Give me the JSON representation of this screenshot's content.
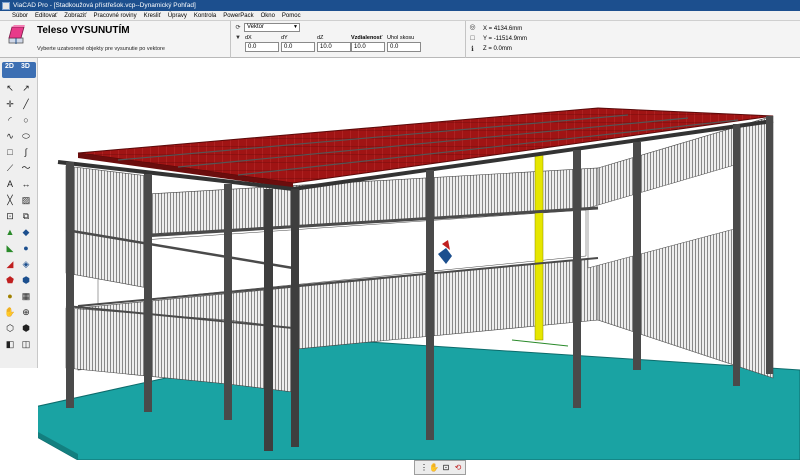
{
  "app": {
    "title": "ViaCAD Pro - [Stadkoužová přístřešok.vcp--Dynamický Pohľad]"
  },
  "menu": [
    "Súbor",
    "Editovať",
    "Zobraziť",
    "Pracovné roviny",
    "Kresliť",
    "Úpravy",
    "Kontrola",
    "PowerPack",
    "Okno",
    "Pomoc"
  ],
  "command": {
    "title": "Teleso VYSUNUTÍM",
    "description": "Vyberte uzatvorené objekty pre vysunutie po vektore",
    "mode": "Vektor",
    "fields": [
      {
        "label": "dX",
        "value": "0.0"
      },
      {
        "label": "dY",
        "value": "0.0"
      },
      {
        "label": "dZ",
        "value": "10.0"
      },
      {
        "label": "Vzdialenosť",
        "value": "10.0"
      },
      {
        "label": "Uhol skosu",
        "value": "0.0"
      }
    ]
  },
  "coords": {
    "x": "X = 4134.6mm",
    "y": "Y = -11514.9mm",
    "z": "Z = 0.0mm"
  },
  "toolbox": {
    "tab_2d": "2D",
    "tab_3d": "3D"
  },
  "colors": {
    "titlebar": "#1c4f8e",
    "roof": "#a01414",
    "floor": "#1aa3a3",
    "steel": "#4a4a4a",
    "highlight": "#e6e600"
  }
}
